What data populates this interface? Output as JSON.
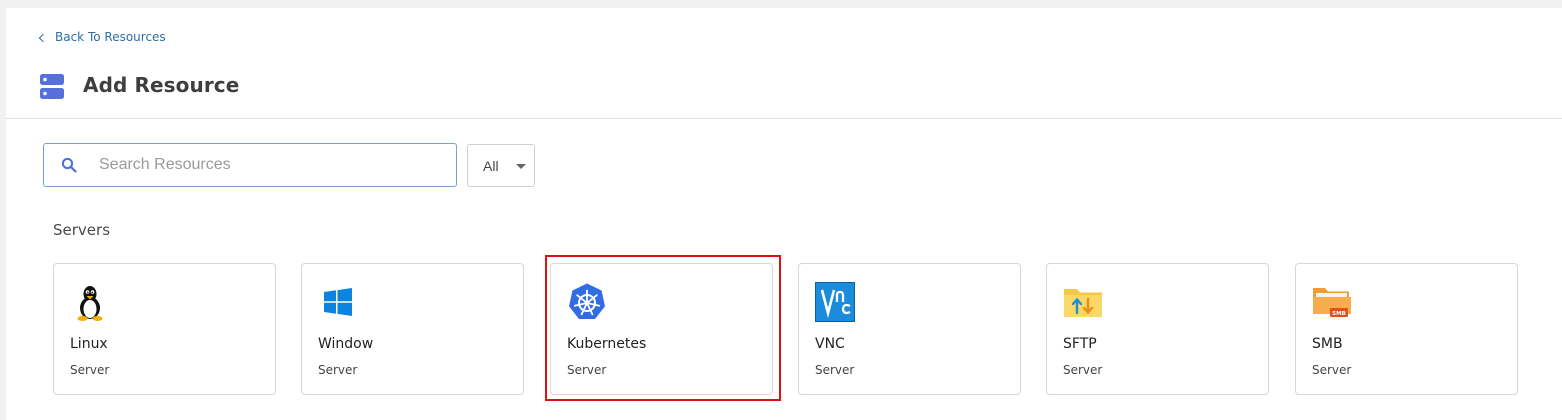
{
  "nav": {
    "back_label": "Back To Resources"
  },
  "header": {
    "title": "Add Resource",
    "icon": "server-icon"
  },
  "search": {
    "placeholder": "Search Resources",
    "value": ""
  },
  "filter": {
    "selected": "All"
  },
  "section": {
    "title": "Servers"
  },
  "cards": [
    {
      "name": "Linux",
      "type": "Server",
      "icon": "linux-tux-icon"
    },
    {
      "name": "Window",
      "type": "Server",
      "icon": "windows-logo-icon"
    },
    {
      "name": "Kubernetes",
      "type": "Server",
      "icon": "kubernetes-icon",
      "highlighted": true
    },
    {
      "name": "VNC",
      "type": "Server",
      "icon": "vnc-icon"
    },
    {
      "name": "SFTP",
      "type": "Server",
      "icon": "sftp-folder-icon"
    },
    {
      "name": "SMB",
      "type": "Server",
      "icon": "smb-folder-icon"
    }
  ],
  "colors": {
    "link": "#2d6fa8",
    "accent": "#4a72d6",
    "highlight": "#e01010",
    "kubernetes": "#326ce5"
  }
}
